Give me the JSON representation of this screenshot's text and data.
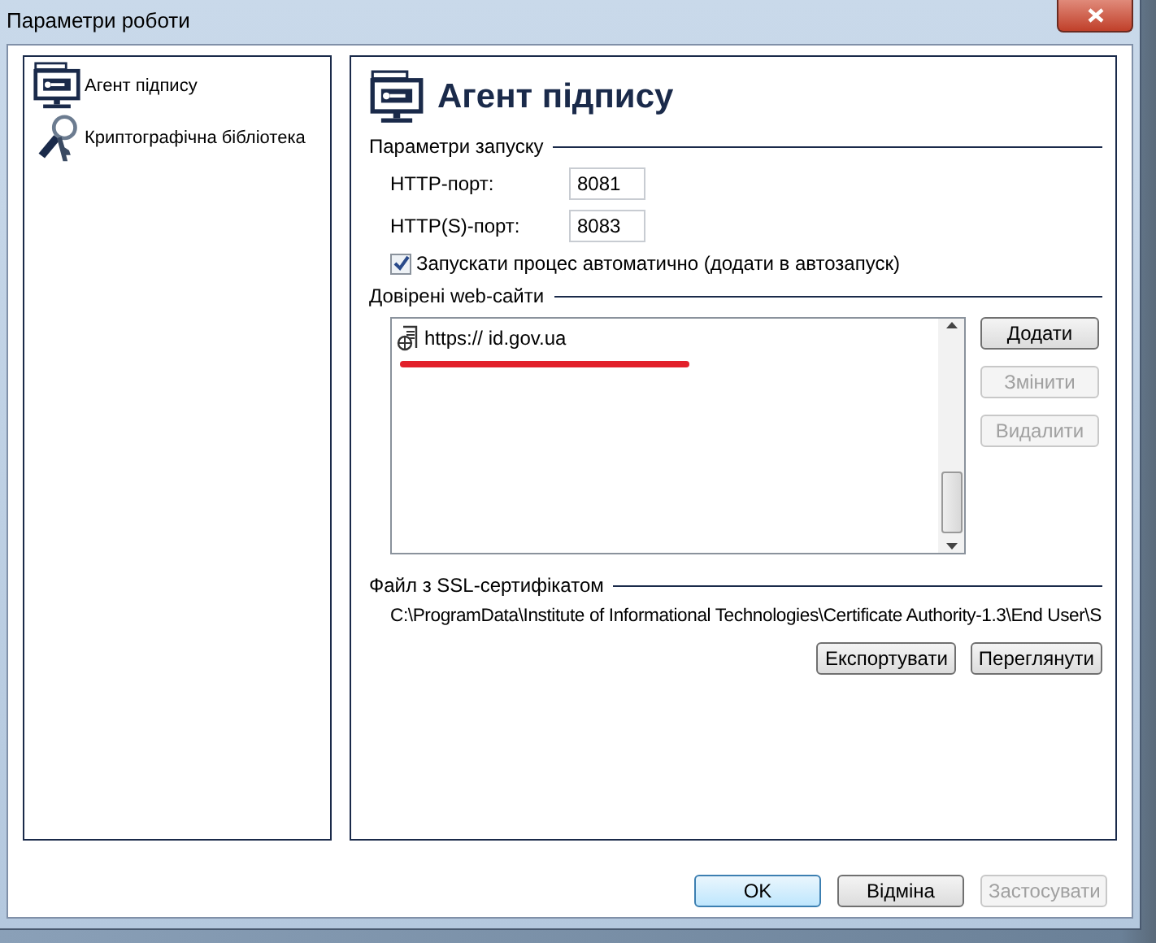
{
  "window": {
    "title": "Параметри роботи"
  },
  "sidebar": {
    "items": [
      {
        "label": "Агент підпису",
        "kind": "monitor",
        "selected": false
      },
      {
        "label": "Криптографічна бібліотека",
        "kind": "keys",
        "selected": false
      }
    ]
  },
  "page": {
    "title": "Агент підпису",
    "launch": {
      "heading": "Параметри запуску",
      "fields": [
        {
          "label": "HTTP-порт:",
          "value": "8081"
        },
        {
          "label": "HTTP(S)-порт:",
          "value": "8083"
        }
      ],
      "autostart": {
        "label": "Запускати процес автоматично (додати в автозапуск)",
        "checked": true
      }
    },
    "sites": {
      "heading": "Довірені web-сайти",
      "items": [
        {
          "url": "https:// id.gov.ua",
          "selected": false
        }
      ],
      "buttons": [
        {
          "label": "Додати",
          "disabled": false
        },
        {
          "label": "Змінити",
          "disabled": true
        },
        {
          "label": "Видалити",
          "disabled": true
        }
      ]
    },
    "certificate": {
      "heading": "Файл з SSL-сертифікатом",
      "path": "C:\\ProgramData\\Institute of Informational Technologies\\Certificate Authority-1.3\\End User\\S",
      "buttons": [
        {
          "label": "Експортувати",
          "disabled": false
        },
        {
          "label": "Переглянути",
          "disabled": false
        }
      ]
    }
  },
  "footer": {
    "buttons": [
      {
        "label": "OK",
        "disabled": false,
        "default": true
      },
      {
        "label": "Відміна",
        "disabled": false,
        "default": false
      },
      {
        "label": "Застосувати",
        "disabled": true,
        "default": false
      }
    ]
  }
}
